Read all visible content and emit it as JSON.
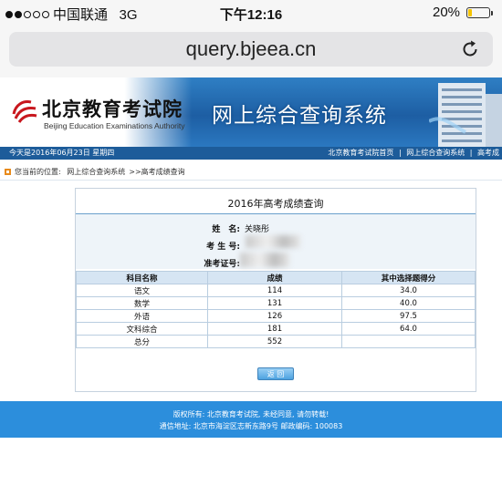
{
  "status_bar": {
    "carrier": "中国联通",
    "network": "3G",
    "time": "下午12:16",
    "battery_percent": "20%",
    "battery_level": 0.2,
    "signal_bars": 2,
    "signal_max": 5
  },
  "browser": {
    "url": "query.bjeea.cn",
    "reload_icon": "reload-icon"
  },
  "banner": {
    "logo_cn": "北京教育考试院",
    "logo_en": "Beijing Education Examinations Authority",
    "system_title": "网上综合查询系统"
  },
  "infobar": {
    "date": "今天是2016年06月23日 星期四",
    "links": [
      "北京教育考试院首页",
      "|",
      "网上综合查询系统",
      "|",
      "高考成"
    ]
  },
  "breadcrumb": {
    "label": "您当前的位置:",
    "items": [
      "网上综合查询系统",
      ">>高考成绩查询"
    ]
  },
  "result": {
    "title": "2016年高考成绩查询",
    "name_label": "姓　名:",
    "name_value": "关晓彤",
    "exam_id_label": "考 生 号:",
    "ticket_label": "准考证号:",
    "table": {
      "headers": [
        "科目名称",
        "成绩",
        "其中选择题得分"
      ],
      "rows": [
        [
          "语文",
          "114",
          "34.0"
        ],
        [
          "数学",
          "131",
          "40.0"
        ],
        [
          "外语",
          "126",
          "97.5"
        ],
        [
          "文科综合",
          "181",
          "64.0"
        ],
        [
          "总分",
          "552",
          ""
        ]
      ]
    },
    "back_button": "返 回"
  },
  "footer": {
    "line1": "版权所有: 北京教育考试院, 未经同意, 请勿转载!",
    "line2": "通信地址: 北京市海淀区志新东路9号 邮政编码: 100083"
  },
  "colors": {
    "banner_blue": "#2f7fc4",
    "infobar_blue": "#1d5c9a",
    "footer_blue": "#2c8edc",
    "logo_red": "#c8171e",
    "battery_yellow": "#f5c400"
  }
}
